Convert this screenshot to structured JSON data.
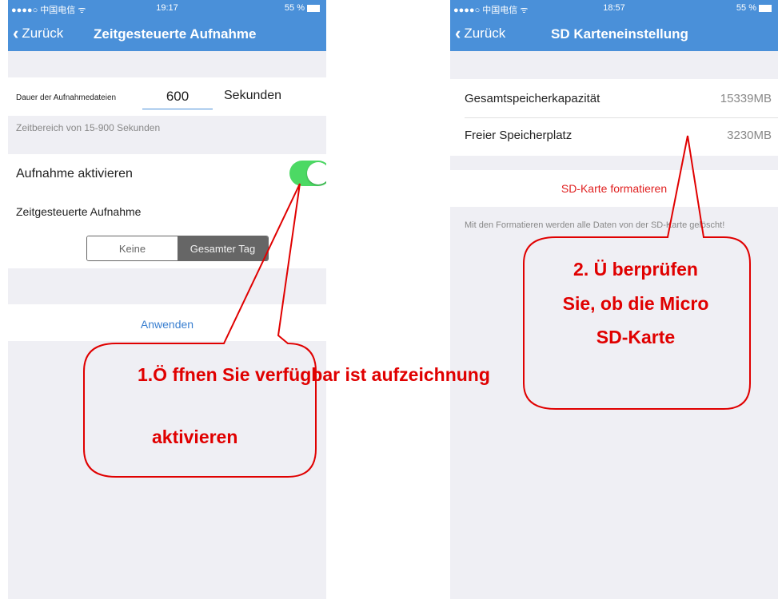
{
  "left_screen": {
    "status": {
      "carrier": "●●●●○ 中国电信 ᯤ",
      "time": "19:17",
      "battery": "55 %"
    },
    "nav": {
      "back_label": "Zurück",
      "title": "Zeitgesteuerte Aufnahme"
    },
    "duration": {
      "label": "Dauer der Aufnahmedateien",
      "value": "600",
      "unit": "Sekunden"
    },
    "range_hint": "Zeitbereich von 15-900 Sekunden",
    "record_enable": {
      "label": "Aufnahme aktivieren",
      "on": true
    },
    "schedule_label": "Zeitgesteuerte Aufnahme",
    "segments": {
      "options": [
        "Keine",
        "Gesamter Tag"
      ],
      "selected": "Gesamter Tag"
    },
    "apply_label": "Anwenden"
  },
  "right_screen": {
    "status": {
      "carrier": "●●●●○ 中国电信 ᯤ",
      "time": "18:57",
      "battery": "55 %"
    },
    "nav": {
      "back_label": "Zurück",
      "title": "SD Karteneinstellung"
    },
    "total_capacity": {
      "label": "Gesamtspeicherkapazität",
      "value": "15339MB"
    },
    "free_space": {
      "label": "Freier Speicherplatz",
      "value": "3230MB"
    },
    "format_label": "SD-Karte formatieren",
    "format_hint": "Mit den Formatieren werden alle Daten von der SD-Karte gelöscht!"
  },
  "annotations": {
    "step1_line1": "1.Ö ffnen Sie verfügbar ist aufzeichnung",
    "step1_line2": "aktivieren",
    "step2_line1": "2. Ü berprüfen",
    "step2_line2": "Sie, ob die Micro",
    "step2_line3": "SD-Karte"
  },
  "colors": {
    "nav": "#4a90d9",
    "toggle_on": "#4cd964",
    "link": "#3a7fd0",
    "destructive": "#e02020",
    "annotation": "#e00000"
  }
}
